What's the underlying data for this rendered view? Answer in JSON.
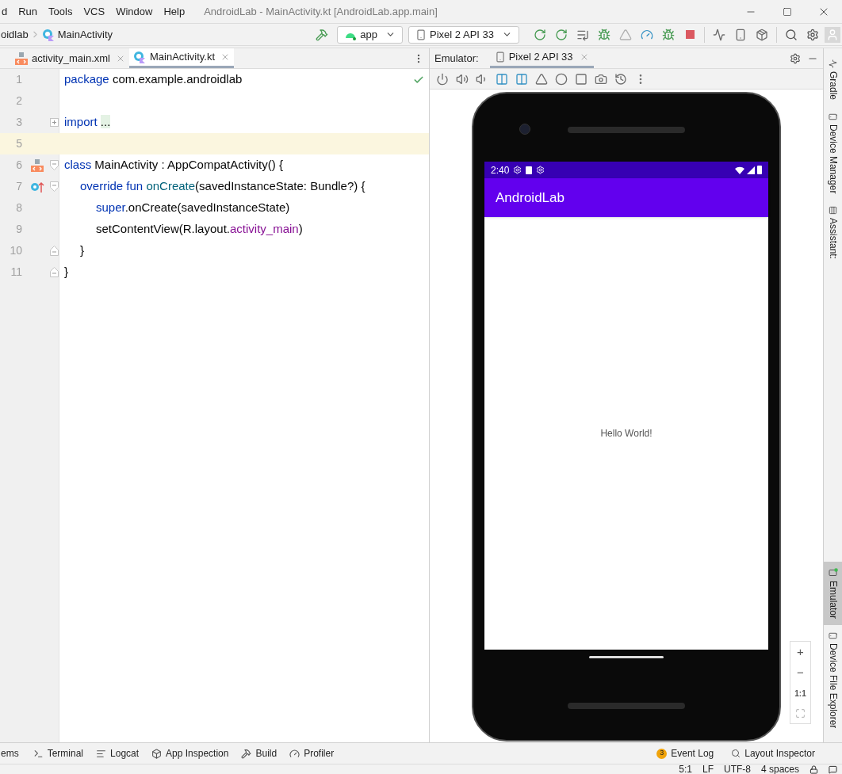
{
  "menu": [
    "d",
    "Run",
    "Tools",
    "VCS",
    "Window",
    "Help"
  ],
  "window": {
    "title": "AndroidLab - MainActivity.kt [AndroidLab.app.main]"
  },
  "breadcrumb": [
    "oidlab",
    "MainActivity"
  ],
  "run_config": {
    "label": "app"
  },
  "device_selector": {
    "label": "Pixel 2 API 33"
  },
  "editor_tabs": [
    {
      "label": "activity_main.xml",
      "kind": "xml",
      "selected": false
    },
    {
      "label": "MainActivity.kt",
      "kind": "kotlin",
      "selected": true
    }
  ],
  "code_lines": [
    {
      "number": "1",
      "current": false,
      "tokens": [
        {
          "kind": "keyword",
          "text": "package "
        },
        {
          "kind": "plain",
          "text": "com.example.androidlab"
        }
      ]
    },
    {
      "number": "2",
      "current": false
    },
    {
      "number": "3",
      "current": false,
      "fold_marker": {
        "kind": "expand"
      },
      "tokens": [
        {
          "kind": "keyword",
          "text": "import "
        },
        {
          "kind": "folded",
          "text": "..."
        }
      ]
    },
    {
      "number": "5",
      "current": true
    },
    {
      "number": "6",
      "current": false,
      "gutter_icon": {
        "kind": "layout"
      },
      "fold_marker": {
        "kind": "start"
      },
      "tokens": [
        {
          "kind": "keyword",
          "text": "class "
        },
        {
          "kind": "plain",
          "text": "MainActivity : AppCompatActivity() {"
        }
      ],
      "children": [
        {
          "number": "7",
          "current": false,
          "gutter_icon": {
            "kind": "override"
          },
          "fold_marker": {
            "kind": "start"
          },
          "tokens": [
            {
              "kind": "keyword",
              "text": "override fun "
            },
            {
              "kind": "function",
              "text": "onCreate"
            },
            {
              "kind": "plain",
              "text": "(savedInstanceState: Bundle?) {"
            }
          ],
          "children": [
            {
              "number": "8",
              "current": false,
              "tokens": [
                {
                  "kind": "keyword",
                  "text": "super"
                },
                {
                  "kind": "plain",
                  "text": ".onCreate(savedInstanceState)"
                }
              ]
            },
            {
              "number": "9",
              "current": false,
              "tokens": [
                {
                  "kind": "plain",
                  "text": "setContentView(R.layout."
                },
                {
                  "kind": "property",
                  "text": "activity_main"
                },
                {
                  "kind": "plain",
                  "text": ")"
                }
              ]
            }
          ]
        },
        {
          "number": "10",
          "current": false,
          "fold_marker": {
            "kind": "end"
          },
          "tokens": [
            {
              "kind": "plain",
              "text": "}"
            }
          ]
        }
      ]
    },
    {
      "number": "11",
      "current": false,
      "fold_marker": {
        "kind": "end"
      },
      "tokens": [
        {
          "kind": "plain",
          "text": "}"
        }
      ]
    }
  ],
  "emulator": {
    "label": "Emulator:",
    "tab": "Pixel 2 API 33"
  },
  "phone": {
    "time": "2:40",
    "app_title": "AndroidLab",
    "content": "Hello World!"
  },
  "zoom_controls": [
    "+",
    "−",
    "1:1"
  ],
  "side_tools_top": [
    {
      "label": "Gradle",
      "kind": "gradle",
      "selected": false
    },
    {
      "label": "Device Manager",
      "kind": "device",
      "selected": false
    },
    {
      "label": "Assistant:",
      "kind": "list",
      "selected": false
    }
  ],
  "side_tools_bottom": [
    {
      "label": "Emulator",
      "kind": "emulator",
      "selected": true
    },
    {
      "label": "Device File Explorer",
      "kind": "device",
      "selected": false
    }
  ],
  "bottom_tools": [
    {
      "label": "ems",
      "kind": "none"
    },
    {
      "label": "Terminal",
      "kind": "terminal"
    },
    {
      "label": "Logcat",
      "kind": "logcat"
    },
    {
      "label": "App Inspection",
      "kind": "inspection"
    },
    {
      "label": "Build",
      "kind": "build"
    },
    {
      "label": "Profiler",
      "kind": "profiler"
    }
  ],
  "event_log": {
    "count": "3",
    "label": "Event Log"
  },
  "layout_inspector": {
    "label": "Layout Inspector"
  },
  "status_bar": [
    "5:1",
    "LF",
    "UTF-8",
    "4 spaces"
  ]
}
